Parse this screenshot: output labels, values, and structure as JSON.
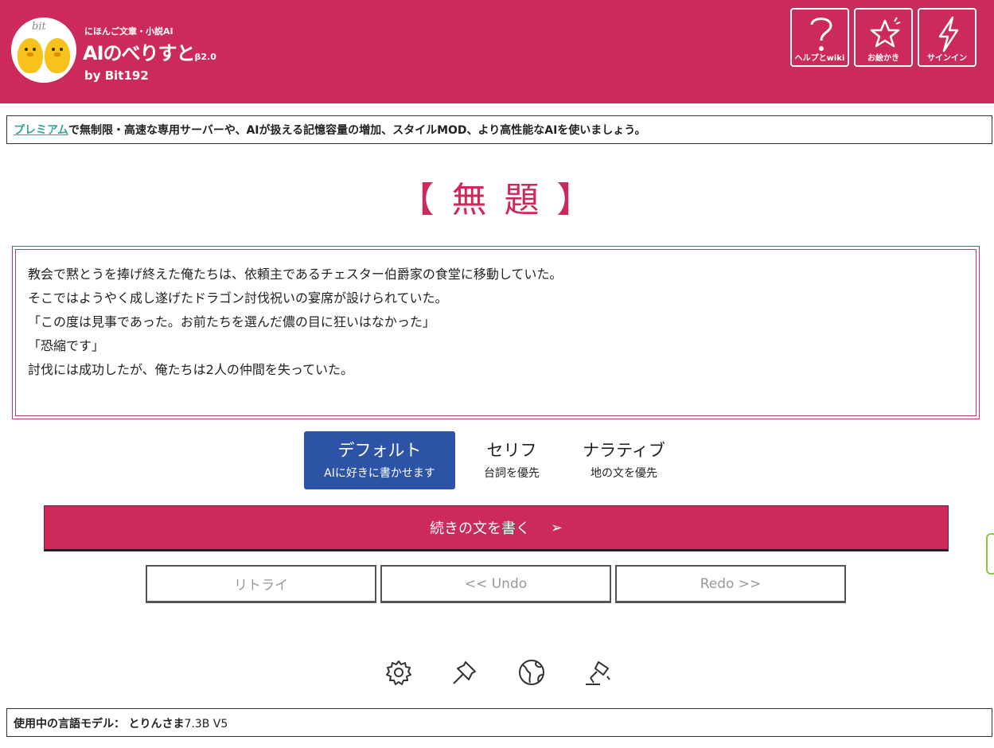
{
  "header": {
    "subtitle": "にほんご文章・小説AI",
    "title": "AIのべりすと",
    "version": "β2.0",
    "by": "by Bit192",
    "logo_text": "bit",
    "buttons": [
      {
        "label": "ヘルプとwiki",
        "icon": "question-icon"
      },
      {
        "label": "お絵かき",
        "icon": "star-icon"
      },
      {
        "label": "サインイン",
        "icon": "lightning-icon"
      }
    ],
    "bg_color": "#cc2a5a"
  },
  "premium": {
    "link": "プレミアム",
    "text": "で無制限・高速な専用サーバーや、AIが扱える記憶容量の増加、スタイルMOD、より高性能なAIを使いましょう。"
  },
  "document": {
    "title": "【 無 題 】",
    "lines": [
      "教会で黙とうを捧げ終えた俺たちは、依頼主であるチェスター伯爵家の食堂に移動していた。",
      "そこではようやく成し遂げたドラゴン討伐祝いの宴席が設けられていた。",
      "「この度は見事であった。お前たちを選んだ儂の目に狂いはなかった」",
      "「恐縮です」",
      "討伐には成功したが、俺たちは2人の仲間を失っていた。"
    ]
  },
  "modes": [
    {
      "name": "デフォルト",
      "desc": "AIに好きに書かせます",
      "active": true
    },
    {
      "name": "セリフ",
      "desc": "台詞を優先",
      "active": false
    },
    {
      "name": "ナラティブ",
      "desc": "地の文を優先",
      "active": false
    }
  ],
  "actions": {
    "continue": "続きの文を書く",
    "continue_arrow": "➢",
    "retry": "リトライ",
    "undo": "<< Undo",
    "redo": "Redo >>"
  },
  "toolbar": [
    "gear-icon",
    "pin-icon",
    "globe-icon",
    "lamp-icon"
  ],
  "model": {
    "label": "使用中の言語モデル：",
    "name": "とりんさま",
    "version": "7.3B V5"
  }
}
